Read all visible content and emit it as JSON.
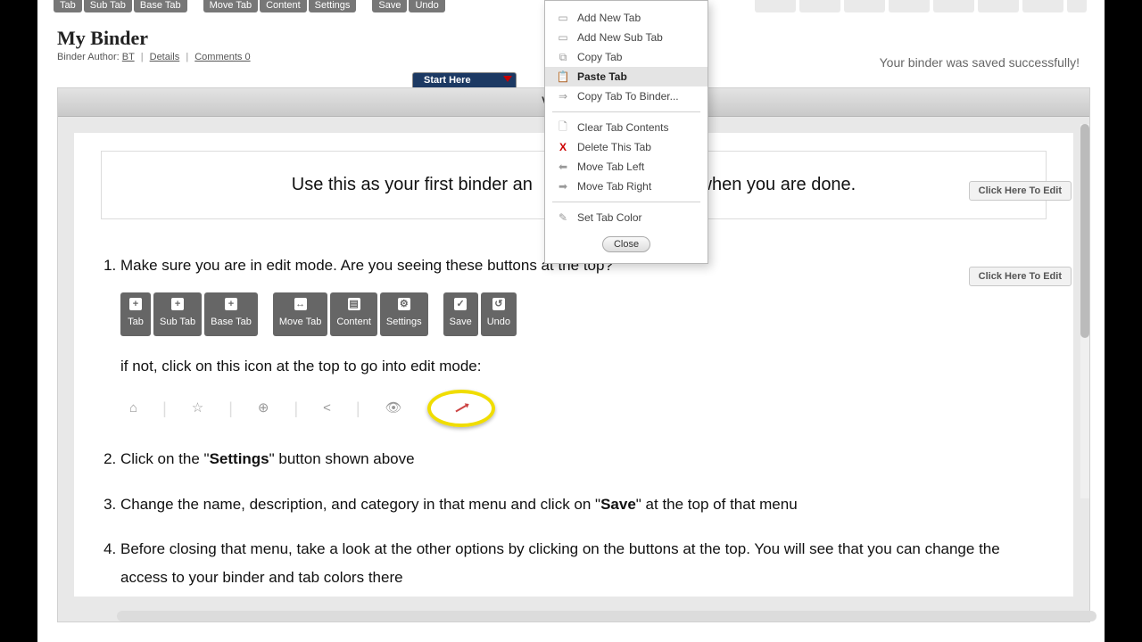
{
  "toolbar": {
    "group1": [
      "Tab",
      "Sub Tab",
      "Base Tab"
    ],
    "group2": [
      "Move Tab",
      "Content",
      "Settings"
    ],
    "group3": [
      "Save",
      "Undo"
    ]
  },
  "header": {
    "title": "My Binder",
    "author_label": "Binder Author:",
    "author_link": "BT",
    "details": "Details",
    "comments": "Comments 0"
  },
  "save_message": "Your binder was saved successfully!",
  "active_tab": {
    "label": "Start Here"
  },
  "video_bar": "Video Versio",
  "edit_button": "Click Here To Edit",
  "intro": {
    "part1": "Use this as your first binder an",
    "part2": "b when you are done."
  },
  "steps": {
    "s1": "Make sure you are in edit mode. Are you seeing these buttons at the top?",
    "s1b": "if not, click on this icon at the top to go into edit mode:",
    "s2_pre": "Click on the \"",
    "s2_b": "Settings",
    "s2_post": "\" button shown above",
    "s3_pre": "Change the name, description, and category in that menu and click on \"",
    "s3_b": "Save",
    "s3_post": "\" at the top of that menu",
    "s4": "Before closing that menu, take a look at the other options by clicking on the buttons at the top. You will see that you can change the access to your binder and tab colors there"
  },
  "mini": {
    "g1": [
      "Tab",
      "Sub Tab",
      "Base Tab"
    ],
    "g2": [
      "Move Tab",
      "Content",
      "Settings"
    ],
    "g3": [
      "Save",
      "Undo"
    ]
  },
  "ctx": {
    "add_tab": "Add New Tab",
    "add_sub": "Add New Sub Tab",
    "copy": "Copy Tab",
    "paste": "Paste Tab",
    "copy_to": "Copy Tab To Binder...",
    "clear": "Clear Tab Contents",
    "delete": "Delete This Tab",
    "move_left": "Move Tab Left",
    "move_right": "Move Tab Right",
    "set_color": "Set Tab Color",
    "close": "Close"
  }
}
